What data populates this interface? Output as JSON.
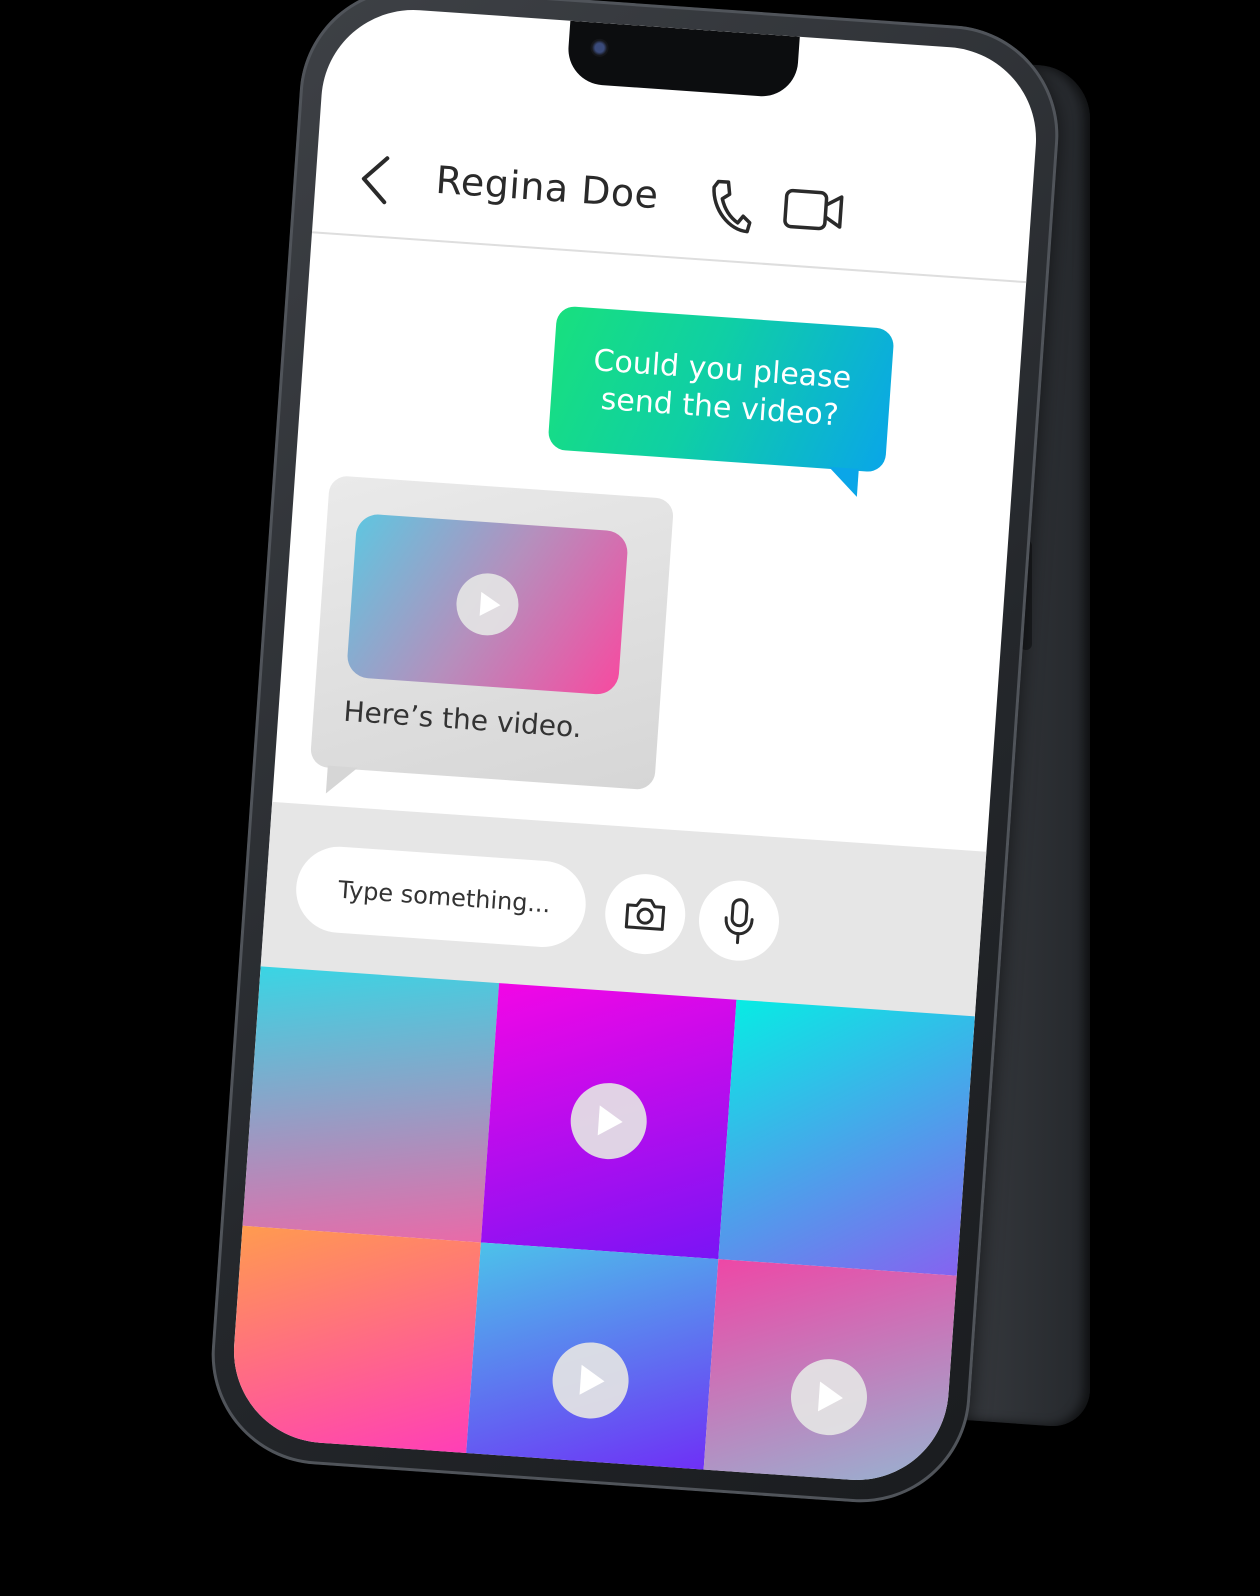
{
  "contact": {
    "name": "Regina Doe"
  },
  "header": {
    "back_icon": "chevron-left-icon",
    "call_icon": "phone-icon",
    "video_icon": "video-camera-icon"
  },
  "messages": {
    "outgoing": {
      "line1": "Could you please",
      "line2": "send the video?"
    },
    "incoming": {
      "caption": "Here’s the video.",
      "media_icon": "play-icon"
    }
  },
  "composer": {
    "placeholder": "Type something...",
    "camera_icon": "camera-icon",
    "mic_icon": "microphone-icon"
  },
  "media_grid": {
    "tiles": [
      {
        "colors": [
          "#39d5e4",
          "#e96aa8"
        ],
        "has_play": false
      },
      {
        "colors": [
          "#f206e6",
          "#7a14f5"
        ],
        "has_play": true
      },
      {
        "colors": [
          "#07ece4",
          "#8563f0"
        ],
        "has_play": false
      },
      {
        "colors": [
          "#ff9b4f",
          "#ff2fc8"
        ],
        "has_play": false
      },
      {
        "colors": [
          "#4cc2ea",
          "#7418f8"
        ],
        "has_play": true
      },
      {
        "colors": [
          "#ee47a6",
          "#87c6d8"
        ],
        "has_play": true
      }
    ]
  },
  "colors": {
    "outgoing_bubble_start": "#18e07e",
    "outgoing_bubble_end": "#0aa6e8",
    "incoming_bubble": "#dddddd"
  }
}
